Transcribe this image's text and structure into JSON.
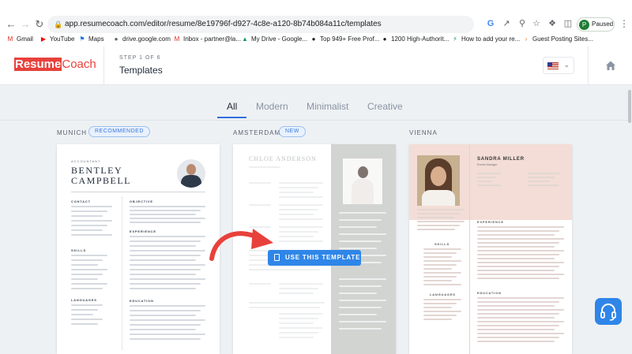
{
  "browser": {
    "url": "app.resumecoach.com/editor/resume/8e19796f-d927-4c8e-a120-8b74b084a11c/templates",
    "profile_label": "Paused",
    "profile_initial": "P",
    "bookmarks": [
      {
        "label": "Gmail",
        "icon": "gmail-icon",
        "color": "#d93025"
      },
      {
        "label": "YouTube",
        "icon": "youtube-icon",
        "color": "#ff0000"
      },
      {
        "label": "Maps",
        "icon": "maps-icon",
        "color": "#1a73e8"
      },
      {
        "label": "drive.google.com",
        "icon": "globe-icon",
        "color": "#5f6368"
      },
      {
        "label": "Inbox - partner@la...",
        "icon": "gmail-icon",
        "color": "#d93025"
      },
      {
        "label": "My Drive - Google...",
        "icon": "drive-icon",
        "color": "#0f9d58"
      },
      {
        "label": "Top 949+ Free Prof...",
        "icon": "globe-icon",
        "color": "#202124"
      },
      {
        "label": "1200 High-Authorit...",
        "icon": "globe-icon",
        "color": "#202124"
      },
      {
        "label": "How to add your re...",
        "icon": "bolt-icon",
        "color": "#0f9d58"
      },
      {
        "label": "Guest Posting Sites...",
        "icon": "chevron-icon",
        "color": "#e8710a"
      }
    ]
  },
  "header": {
    "logo_resume": "Resume",
    "logo_coach": "Coach",
    "step": "STEP 1 OF 6",
    "title": "Templates"
  },
  "tabs": [
    {
      "label": "All",
      "active": true
    },
    {
      "label": "Modern",
      "active": false
    },
    {
      "label": "Minimalist",
      "active": false
    },
    {
      "label": "Creative",
      "active": false
    }
  ],
  "templates": [
    {
      "name": "MUNICH",
      "badge": "RECOMMENDED"
    },
    {
      "name": "AMSTERDAM",
      "badge": "NEW"
    },
    {
      "name": "VIENNA",
      "badge": ""
    }
  ],
  "munich": {
    "role": "ACCOUNTANT",
    "first_name": "BENTLEY",
    "last_name": "CAMPBELL",
    "sections": [
      "CONTACT",
      "OBJECTIVE",
      "EXPERIENCE",
      "SKILLS",
      "LANGUAGES",
      "EDUCATION"
    ]
  },
  "amsterdam": {
    "name": "CHLOE ANDERSON",
    "use_button": "USE THIS TEMPLATE"
  },
  "vienna": {
    "name": "SANDRA MILLER",
    "role": "Events Manager",
    "sections": [
      "EXPERIENCE",
      "SKILLS",
      "LANGUAGES",
      "EDUCATION"
    ]
  }
}
